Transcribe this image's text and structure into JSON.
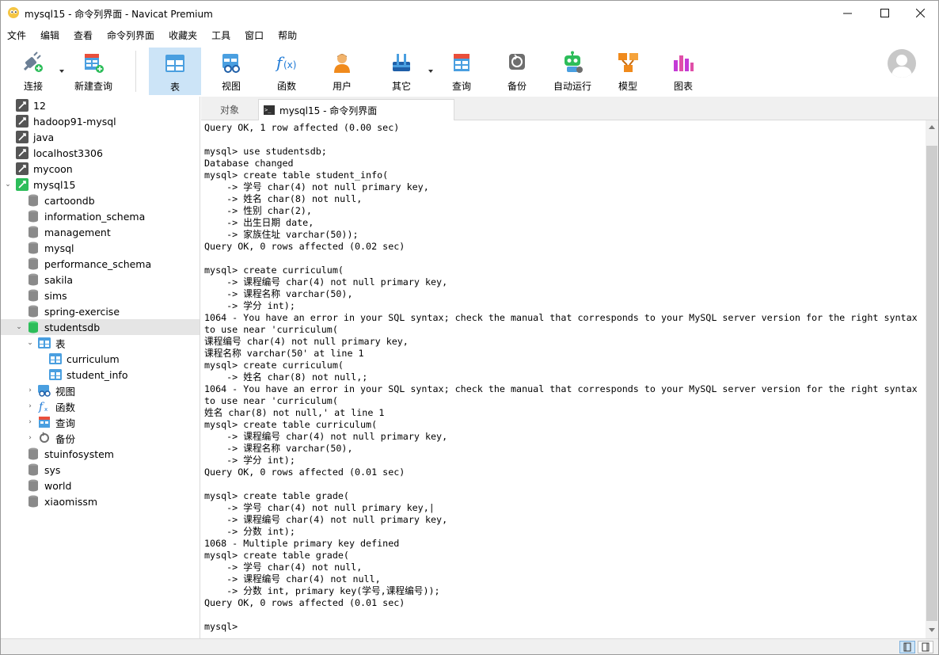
{
  "window": {
    "title": "mysql15 - 命令列界面 - Navicat Premium",
    "minimize": "—",
    "maximize": "☐",
    "close": "✕"
  },
  "menu": [
    "文件",
    "编辑",
    "查看",
    "命令列界面",
    "收藏夹",
    "工具",
    "窗口",
    "帮助"
  ],
  "toolbar": {
    "connect": "连接",
    "new_query": "新建查询",
    "table": "表",
    "view": "视图",
    "function": "函数",
    "user": "用户",
    "other": "其它",
    "query": "查询",
    "backup": "备份",
    "automation": "自动运行",
    "model": "模型",
    "chart": "图表"
  },
  "sidebar": {
    "connections": [
      {
        "label": "12"
      },
      {
        "label": "hadoop91-mysql"
      },
      {
        "label": "java"
      },
      {
        "label": "localhost3306"
      },
      {
        "label": "mycoon"
      },
      {
        "label": "mysql15"
      }
    ],
    "databases": [
      {
        "label": "cartoondb"
      },
      {
        "label": "information_schema"
      },
      {
        "label": "management"
      },
      {
        "label": "mysql"
      },
      {
        "label": "performance_schema"
      },
      {
        "label": "sakila"
      },
      {
        "label": "sims"
      },
      {
        "label": "spring-exercise"
      },
      {
        "label": "studentsdb"
      }
    ],
    "studentsdb_children": {
      "tables": "表",
      "table_items": [
        {
          "label": "curriculum"
        },
        {
          "label": "student_info"
        }
      ],
      "views": "视图",
      "functions": "函数",
      "queries": "查询",
      "backups": "备份"
    },
    "more_databases": [
      {
        "label": "stuinfosystem"
      },
      {
        "label": "sys"
      },
      {
        "label": "world"
      },
      {
        "label": "xiaomissm"
      }
    ]
  },
  "tabs": {
    "objects": "对象",
    "console": "mysql15 - 命令列界面"
  },
  "console": {
    "lines": [
      "Query OK, 1 row affected (0.00 sec)",
      "",
      "mysql> use studentsdb;",
      "Database changed",
      "mysql> create table student_info(",
      "    -> 学号 char(4) not null primary key,",
      "    -> 姓名 char(8) not null,",
      "    -> 性别 char(2),",
      "    -> 出生日期 date,",
      "    -> 家族住址 varchar(50));",
      "Query OK, 0 rows affected (0.02 sec)",
      "",
      "mysql> create curriculum(",
      "    -> 课程编号 char(4) not null primary key,",
      "    -> 课程名称 varchar(50),",
      "    -> 学分 int);",
      "1064 - You have an error in your SQL syntax; check the manual that corresponds to your MySQL server version for the right syntax",
      "to use near 'curriculum(",
      "课程编号 char(4) not null primary key,",
      "课程名称 varchar(50' at line 1",
      "mysql> create curriculum(",
      "    -> 姓名 char(8) not null,;",
      "1064 - You have an error in your SQL syntax; check the manual that corresponds to your MySQL server version for the right syntax",
      "to use near 'curriculum(",
      "姓名 char(8) not null,' at line 1",
      "mysql> create table curriculum(",
      "    -> 课程编号 char(4) not null primary key,",
      "    -> 课程名称 varchar(50),",
      "    -> 学分 int);",
      "Query OK, 0 rows affected (0.01 sec)",
      "",
      "mysql> create table grade(",
      "    -> 学号 char(4) not null primary key,|",
      "    -> 课程编号 char(4) not null primary key,",
      "    -> 分数 int);",
      "1068 - Multiple primary key defined",
      "mysql> create table grade(",
      "    -> 学号 char(4) not null,",
      "    -> 课程编号 char(4) not null,",
      "    -> 分数 int, primary key(学号,课程编号));",
      "Query OK, 0 rows affected (0.01 sec)",
      "",
      "mysql>"
    ]
  },
  "colors": {
    "accent_selected": "#cce4f7",
    "db_green": "#2dbd5a",
    "db_gray": "#8a8a8a",
    "table_blue": "#4a9fe0"
  }
}
